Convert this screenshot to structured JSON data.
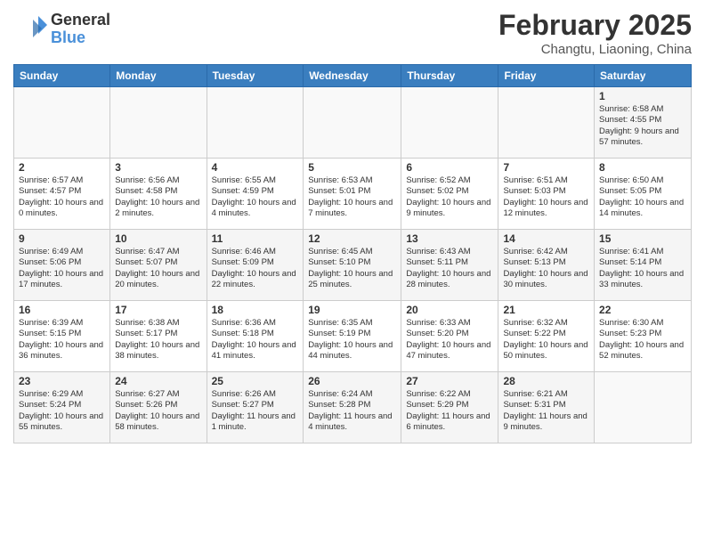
{
  "header": {
    "logo_general": "General",
    "logo_blue": "Blue",
    "month_title": "February 2025",
    "location": "Changtu, Liaoning, China"
  },
  "weekdays": [
    "Sunday",
    "Monday",
    "Tuesday",
    "Wednesday",
    "Thursday",
    "Friday",
    "Saturday"
  ],
  "weeks": [
    [
      {
        "day": "",
        "info": ""
      },
      {
        "day": "",
        "info": ""
      },
      {
        "day": "",
        "info": ""
      },
      {
        "day": "",
        "info": ""
      },
      {
        "day": "",
        "info": ""
      },
      {
        "day": "",
        "info": ""
      },
      {
        "day": "1",
        "info": "Sunrise: 6:58 AM\nSunset: 4:55 PM\nDaylight: 9 hours and 57 minutes."
      }
    ],
    [
      {
        "day": "2",
        "info": "Sunrise: 6:57 AM\nSunset: 4:57 PM\nDaylight: 10 hours and 0 minutes."
      },
      {
        "day": "3",
        "info": "Sunrise: 6:56 AM\nSunset: 4:58 PM\nDaylight: 10 hours and 2 minutes."
      },
      {
        "day": "4",
        "info": "Sunrise: 6:55 AM\nSunset: 4:59 PM\nDaylight: 10 hours and 4 minutes."
      },
      {
        "day": "5",
        "info": "Sunrise: 6:53 AM\nSunset: 5:01 PM\nDaylight: 10 hours and 7 minutes."
      },
      {
        "day": "6",
        "info": "Sunrise: 6:52 AM\nSunset: 5:02 PM\nDaylight: 10 hours and 9 minutes."
      },
      {
        "day": "7",
        "info": "Sunrise: 6:51 AM\nSunset: 5:03 PM\nDaylight: 10 hours and 12 minutes."
      },
      {
        "day": "8",
        "info": "Sunrise: 6:50 AM\nSunset: 5:05 PM\nDaylight: 10 hours and 14 minutes."
      }
    ],
    [
      {
        "day": "9",
        "info": "Sunrise: 6:49 AM\nSunset: 5:06 PM\nDaylight: 10 hours and 17 minutes."
      },
      {
        "day": "10",
        "info": "Sunrise: 6:47 AM\nSunset: 5:07 PM\nDaylight: 10 hours and 20 minutes."
      },
      {
        "day": "11",
        "info": "Sunrise: 6:46 AM\nSunset: 5:09 PM\nDaylight: 10 hours and 22 minutes."
      },
      {
        "day": "12",
        "info": "Sunrise: 6:45 AM\nSunset: 5:10 PM\nDaylight: 10 hours and 25 minutes."
      },
      {
        "day": "13",
        "info": "Sunrise: 6:43 AM\nSunset: 5:11 PM\nDaylight: 10 hours and 28 minutes."
      },
      {
        "day": "14",
        "info": "Sunrise: 6:42 AM\nSunset: 5:13 PM\nDaylight: 10 hours and 30 minutes."
      },
      {
        "day": "15",
        "info": "Sunrise: 6:41 AM\nSunset: 5:14 PM\nDaylight: 10 hours and 33 minutes."
      }
    ],
    [
      {
        "day": "16",
        "info": "Sunrise: 6:39 AM\nSunset: 5:15 PM\nDaylight: 10 hours and 36 minutes."
      },
      {
        "day": "17",
        "info": "Sunrise: 6:38 AM\nSunset: 5:17 PM\nDaylight: 10 hours and 38 minutes."
      },
      {
        "day": "18",
        "info": "Sunrise: 6:36 AM\nSunset: 5:18 PM\nDaylight: 10 hours and 41 minutes."
      },
      {
        "day": "19",
        "info": "Sunrise: 6:35 AM\nSunset: 5:19 PM\nDaylight: 10 hours and 44 minutes."
      },
      {
        "day": "20",
        "info": "Sunrise: 6:33 AM\nSunset: 5:20 PM\nDaylight: 10 hours and 47 minutes."
      },
      {
        "day": "21",
        "info": "Sunrise: 6:32 AM\nSunset: 5:22 PM\nDaylight: 10 hours and 50 minutes."
      },
      {
        "day": "22",
        "info": "Sunrise: 6:30 AM\nSunset: 5:23 PM\nDaylight: 10 hours and 52 minutes."
      }
    ],
    [
      {
        "day": "23",
        "info": "Sunrise: 6:29 AM\nSunset: 5:24 PM\nDaylight: 10 hours and 55 minutes."
      },
      {
        "day": "24",
        "info": "Sunrise: 6:27 AM\nSunset: 5:26 PM\nDaylight: 10 hours and 58 minutes."
      },
      {
        "day": "25",
        "info": "Sunrise: 6:26 AM\nSunset: 5:27 PM\nDaylight: 11 hours and 1 minute."
      },
      {
        "day": "26",
        "info": "Sunrise: 6:24 AM\nSunset: 5:28 PM\nDaylight: 11 hours and 4 minutes."
      },
      {
        "day": "27",
        "info": "Sunrise: 6:22 AM\nSunset: 5:29 PM\nDaylight: 11 hours and 6 minutes."
      },
      {
        "day": "28",
        "info": "Sunrise: 6:21 AM\nSunset: 5:31 PM\nDaylight: 11 hours and 9 minutes."
      },
      {
        "day": "",
        "info": ""
      }
    ]
  ]
}
